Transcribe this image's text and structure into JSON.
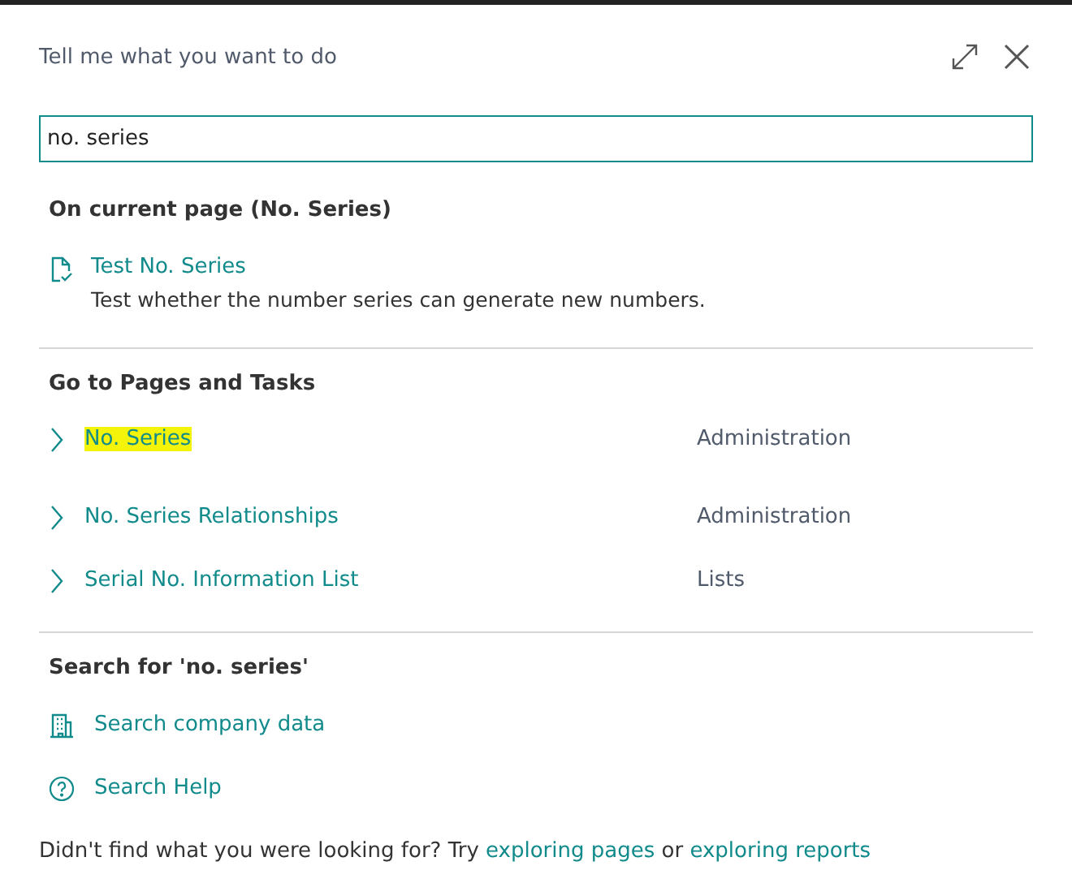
{
  "dialog": {
    "title": "Tell me what you want to do"
  },
  "search": {
    "value": "no. series"
  },
  "current_page": {
    "heading": "On current page (No. Series)",
    "items": [
      {
        "label": "Test No. Series",
        "description": "Test whether the number series can generate new numbers."
      }
    ]
  },
  "pages_and_tasks": {
    "heading": "Go to Pages and Tasks",
    "items": [
      {
        "label": "No. Series",
        "category": "Administration",
        "highlighted": true
      },
      {
        "label": "No. Series Relationships",
        "category": "Administration",
        "highlighted": false
      },
      {
        "label": "Serial No. Information List",
        "category": "Lists",
        "highlighted": false
      }
    ]
  },
  "search_for": {
    "heading": "Search for 'no. series'",
    "items": [
      {
        "kind": "company",
        "label": "Search company data"
      },
      {
        "kind": "help",
        "label": "Search Help"
      }
    ]
  },
  "footer": {
    "parts": [
      {
        "kind": "text",
        "text": "Didn't find what you were looking for? Try "
      },
      {
        "kind": "link",
        "text": "exploring pages"
      },
      {
        "kind": "text",
        "text": " or "
      },
      {
        "kind": "link",
        "text": "exploring reports"
      }
    ]
  }
}
